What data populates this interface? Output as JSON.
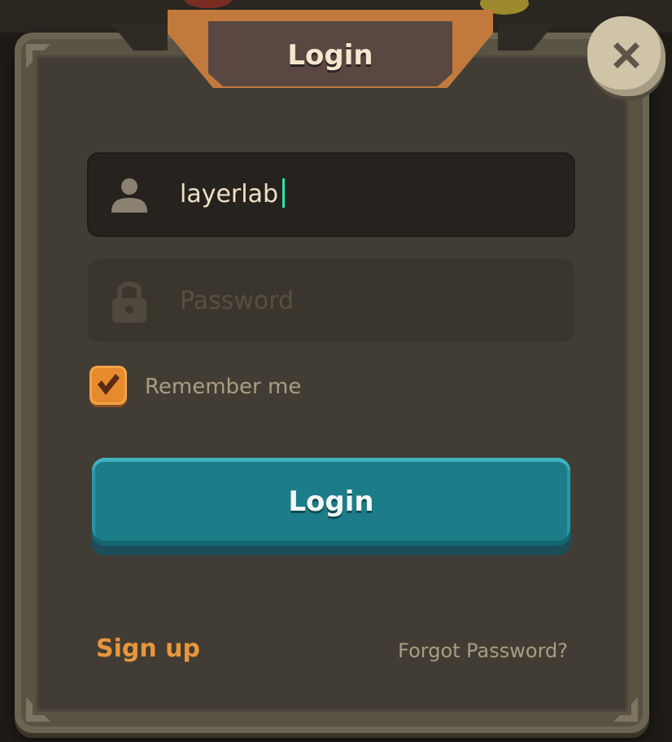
{
  "dialog": {
    "title": "Login",
    "close_icon": "close-x-icon"
  },
  "form": {
    "username": {
      "value": "layerlab",
      "icon": "user-icon"
    },
    "password": {
      "placeholder": "Password",
      "icon": "lock-icon"
    },
    "remember_me": {
      "label": "Remember me",
      "checked": true
    },
    "submit_label": "Login"
  },
  "footer": {
    "signup_label": "Sign up",
    "forgot_label": "Forgot Password?"
  },
  "colors": {
    "panel": "#423d34",
    "accent_orange": "#e8963c",
    "button_teal": "#1c7c87",
    "caret": "#2de0b0"
  }
}
